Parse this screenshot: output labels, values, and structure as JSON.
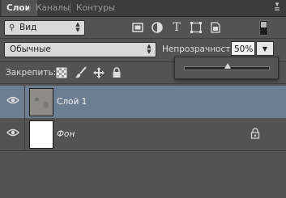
{
  "tabs": [
    {
      "label": "Слои",
      "active": true
    },
    {
      "label": "Каналы",
      "active": false
    },
    {
      "label": "Контуры",
      "active": false
    }
  ],
  "filter": {
    "kind_label": "Вид",
    "icons": [
      "image-filter-icon",
      "adjustment-filter-icon",
      "text-filter-icon",
      "shape-filter-icon",
      "smart-object-filter-icon"
    ],
    "text_icon_glyph": "T"
  },
  "blend": {
    "mode": "Обычные",
    "opacity_label": "Непрозрачность:",
    "opacity_value": "50%",
    "opacity_fraction": 0.5
  },
  "lock": {
    "label": "Закрепить:",
    "icons": [
      "lock-transparent-pixels-icon",
      "lock-image-pixels-icon",
      "lock-position-icon",
      "lock-all-icon"
    ]
  },
  "layers": [
    {
      "name": "Слой 1",
      "selected": true,
      "visible": true
    },
    {
      "name": "Фон",
      "selected": false,
      "visible": true,
      "locked": true
    }
  ],
  "colors": {
    "panel_bg": "#535353",
    "selected_layer": "#6d7e93",
    "tab_bar": "#3c3c3c"
  }
}
